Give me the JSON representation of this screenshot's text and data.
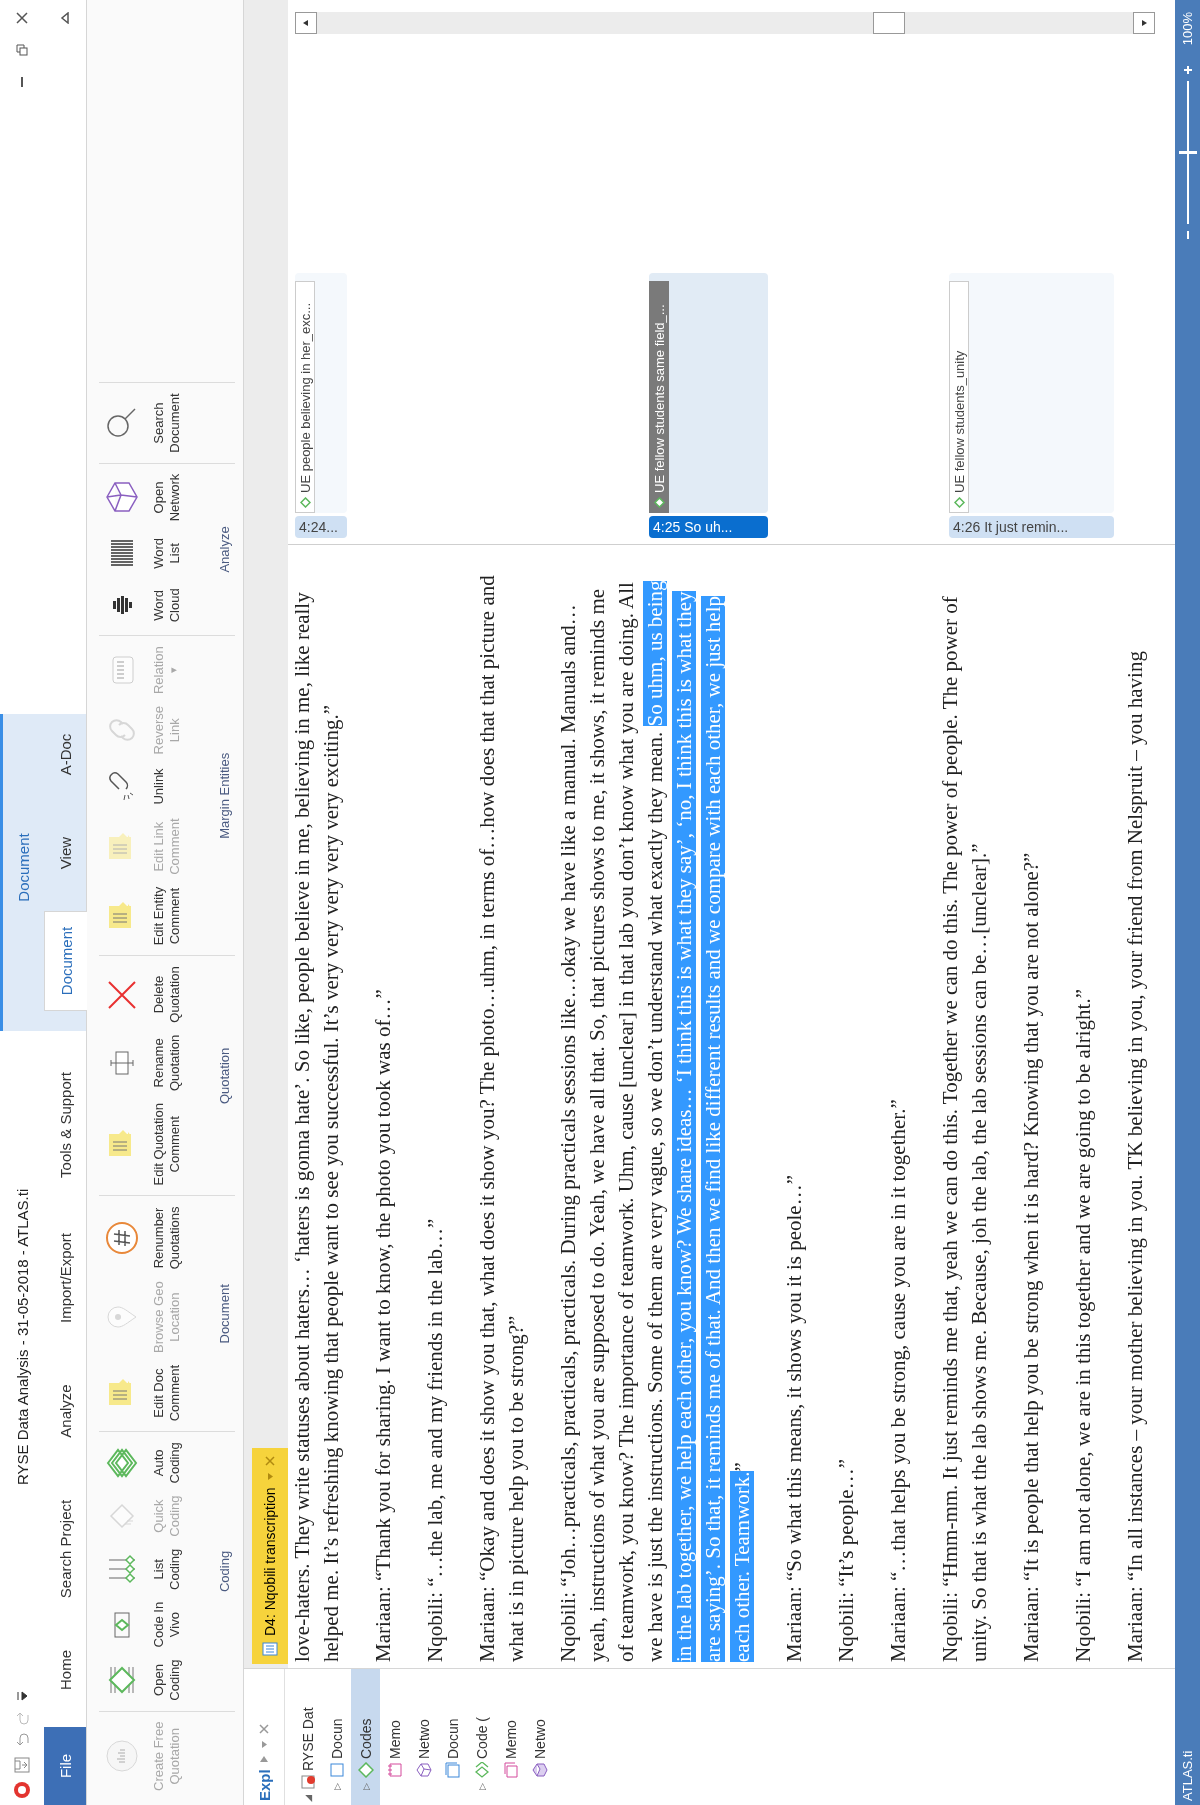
{
  "window": {
    "title": "RYSE Data Analysis - 31-05-2018 - ATLAS.ti",
    "context_tab_group": "Document"
  },
  "tabs": [
    {
      "label": "File",
      "kind": "file",
      "selected": false
    },
    {
      "label": "Home",
      "kind": "tab",
      "selected": false
    },
    {
      "label": "Search Project",
      "kind": "tab",
      "selected": false
    },
    {
      "label": "Analyze",
      "kind": "tab",
      "selected": false
    },
    {
      "label": "Import/Export",
      "kind": "tab",
      "selected": false
    },
    {
      "label": "Tools & Support",
      "kind": "tab",
      "selected": false
    },
    {
      "label": "Document",
      "kind": "context",
      "selected": true
    },
    {
      "label": "View",
      "kind": "context",
      "selected": false
    },
    {
      "label": "A-Doc",
      "kind": "context",
      "selected": false
    }
  ],
  "ribbon": {
    "groups": [
      {
        "buttons": [
          {
            "label": [
              "Create Free",
              "Quotation"
            ],
            "kind": "quote-circle",
            "disabled": true
          }
        ]
      },
      {
        "label": "Coding",
        "buttons": [
          {
            "label": [
              "Open",
              "Coding"
            ],
            "kind": "open-coding",
            "disabled": false
          },
          {
            "label": [
              "Code In",
              "Vivo"
            ],
            "kind": "in-vivo",
            "disabled": false
          },
          {
            "label": [
              "List",
              "Coding"
            ],
            "kind": "list-coding",
            "disabled": false
          },
          {
            "label": [
              "Quick",
              "Coding"
            ],
            "kind": "quick-coding",
            "disabled": true
          },
          {
            "label": [
              "Auto",
              "Coding"
            ],
            "kind": "auto-coding",
            "disabled": false
          }
        ]
      },
      {
        "label": "Document",
        "buttons": [
          {
            "label": [
              "Edit Doc",
              "Comment"
            ],
            "kind": "note",
            "disabled": false
          },
          {
            "label": [
              "Browse Geo",
              "Location"
            ],
            "kind": "pin",
            "disabled": true
          },
          {
            "label": [
              "Renumber",
              "Quotations"
            ],
            "kind": "hash",
            "disabled": false
          }
        ]
      },
      {
        "label": "Quotation",
        "buttons": [
          {
            "label": [
              "Edit Quotation",
              "Comment"
            ],
            "kind": "note",
            "disabled": false
          },
          {
            "label": [
              "Rename",
              "Quotation"
            ],
            "kind": "rename",
            "disabled": false
          },
          {
            "label": [
              "Delete",
              "Quotation"
            ],
            "kind": "delete",
            "disabled": false
          }
        ]
      },
      {
        "label": "Margin Entities",
        "buttons": [
          {
            "label": [
              "Edit Entity",
              "Comment"
            ],
            "kind": "note",
            "disabled": false
          },
          {
            "label": [
              "Edit Link",
              "Comment"
            ],
            "kind": "note",
            "disabled": true
          },
          {
            "label": [
              "Unlink"
            ],
            "kind": "unlink",
            "disabled": false
          },
          {
            "label": [
              "Reverse",
              "Link"
            ],
            "kind": "chain",
            "disabled": true
          },
          {
            "label": [
              "Relation"
            ],
            "kind": "relation",
            "disabled": true,
            "caret": "▾"
          }
        ]
      },
      {
        "label": "Analyze",
        "buttons": [
          {
            "label": [
              "Word",
              "Cloud"
            ],
            "kind": "cloud",
            "disabled": false
          },
          {
            "label": [
              "Word",
              "List"
            ],
            "kind": "wordlist",
            "disabled": false
          },
          {
            "label": [
              "Open",
              "Network"
            ],
            "kind": "network",
            "disabled": false
          }
        ]
      },
      {
        "buttons": [
          {
            "label": [
              "Search",
              "Document"
            ],
            "kind": "search",
            "disabled": false
          }
        ]
      }
    ]
  },
  "explorer": {
    "title": "Expl",
    "items": [
      {
        "label": "RYSE Dat",
        "kind": "project",
        "arrow": "◢",
        "selected": false,
        "children": [
          {
            "label": "Docun",
            "kind": "documents",
            "arrow": "▷",
            "selected": false
          },
          {
            "label": "Codes",
            "kind": "codes",
            "arrow": "▷",
            "selected": true
          },
          {
            "label": "Memo",
            "kind": "memos",
            "selected": false
          },
          {
            "label": "Netwo",
            "kind": "networks",
            "selected": false
          },
          {
            "label": "Docun",
            "kind": "document-groups",
            "selected": false
          },
          {
            "label": "Code (",
            "kind": "code-groups",
            "arrow": "▷",
            "selected": false
          },
          {
            "label": "Memo",
            "kind": "memo-groups",
            "selected": false
          },
          {
            "label": "Netwo",
            "kind": "network-groups",
            "selected": false
          }
        ]
      }
    ]
  },
  "document_tab": {
    "title": "D4: Nqobili transcription"
  },
  "transcript": [
    {
      "lines": [
        [
          {
            "text": "love-haters. They write statuses about haters… ‘haters is gonna hate’. So like, people believe in me, believing in me, like really",
            "highlighted": false
          }
        ],
        [
          {
            "text": "helped me. It’s refreshing knowing that people want to see you successful. It’s very very very very very exciting.”",
            "highlighted": false
          }
        ]
      ]
    },
    {
      "lines": [
        [
          {
            "text": "Mariaan: “Thank you for sharing. I want to know, the photo you took was of…”",
            "highlighted": false
          }
        ]
      ]
    },
    {
      "lines": [
        [
          {
            "text": "Nqobili: “…the lab, me and my friends in the lab…”",
            "highlighted": false
          }
        ]
      ]
    },
    {
      "lines": [
        [
          {
            "text": "Mariaan: “Okay and does it show you that, what does it show you? The photo…uhm, in terms of…how does that that picture and",
            "highlighted": false
          }
        ],
        [
          {
            "text": "what is in picture help you to be strong?”",
            "highlighted": false
          }
        ]
      ]
    },
    {
      "lines": [
        [
          {
            "text": "Nqobili: “Joh…practicals, practicals, practicals. During practicals sessions like…okay we have like a manual. Manuals and…",
            "highlighted": false
          }
        ],
        [
          {
            "text": "yeah, instructions of what you are supposed to do. Yeah, we have all that. So, that pictures shows to me, it shows, it reminds me",
            "highlighted": false
          }
        ],
        [
          {
            "text": "of teamwork, you know? The importance of teamwork. Uhm, cause [unclear] in that lab you don’t know what you are doing. All",
            "highlighted": false
          }
        ],
        [
          {
            "text": "we have is just the instructions. Some of them are very vague, so we don’t understand what exactly they mean. ",
            "highlighted": false
          },
          {
            "text": "So uhm, us being",
            "highlighted": true
          }
        ],
        [
          {
            "text": "in the lab together, we help each other, you know? We share ideas… ‘I think this is what they say’, ‘no, I think this is what they",
            "highlighted": true
          }
        ],
        [
          {
            "text": "are saying’. So that, it reminds me of that. And then we find like different results and we compare with each other, we just help",
            "highlighted": true
          }
        ],
        [
          {
            "text": "each other. Teamwork.",
            "highlighted": true
          },
          {
            "text": "”",
            "highlighted": false
          }
        ]
      ]
    },
    {
      "lines": [
        [
          {
            "text": "Mariaan: “So what this means, it shows you it is peole…”",
            "highlighted": false
          }
        ]
      ]
    },
    {
      "lines": [
        [
          {
            "text": "Nqobili: “It’s people…”",
            "highlighted": false
          }
        ]
      ]
    },
    {
      "lines": [
        [
          {
            "text": "Mariaan: “…that helps you be strong, cause you are in it together.”",
            "highlighted": false
          }
        ]
      ]
    },
    {
      "lines": [
        [
          {
            "text": "Nqobili: “Hmm-mm. It just reminds me that, yeah we can do this. Together we can do this. The power of people. The power of",
            "highlighted": false
          }
        ],
        [
          {
            "text": "unity. So that is what the lab shows me. Because, joh the lab, the lab sessions can be…[unclear].”",
            "highlighted": false
          }
        ]
      ]
    },
    {
      "lines": [
        [
          {
            "text": "Mariaan: “It is people that help you be strong when it is hard? Knowing that you are not alone?”",
            "highlighted": false
          }
        ]
      ]
    },
    {
      "lines": [
        [
          {
            "text": "Nqobili: “I am not alone, we are in this together and we are going to be alright.”",
            "highlighted": false
          }
        ]
      ]
    },
    {
      "lines": [
        [
          {
            "text": "Mariaan: “In all instances – your mother believing in you. TK believing in you, your friend from Nelspruit – you having",
            "highlighted": false
          }
        ]
      ]
    }
  ],
  "margin": [
    {
      "quotation": "4:24...",
      "code": "UE people believing in her_exc...",
      "selected": false
    },
    {
      "quotation": "4:25 So uh...",
      "code": "UE fellow students same field_...",
      "selected": true
    },
    {
      "quotation": "4:26 It just remin...",
      "code": "UE fellow students_unity",
      "selected": false
    }
  ],
  "status_bar": {
    "label": "ATLAS.ti",
    "zoom": {
      "level": 0.5,
      "reading": "100%"
    }
  }
}
